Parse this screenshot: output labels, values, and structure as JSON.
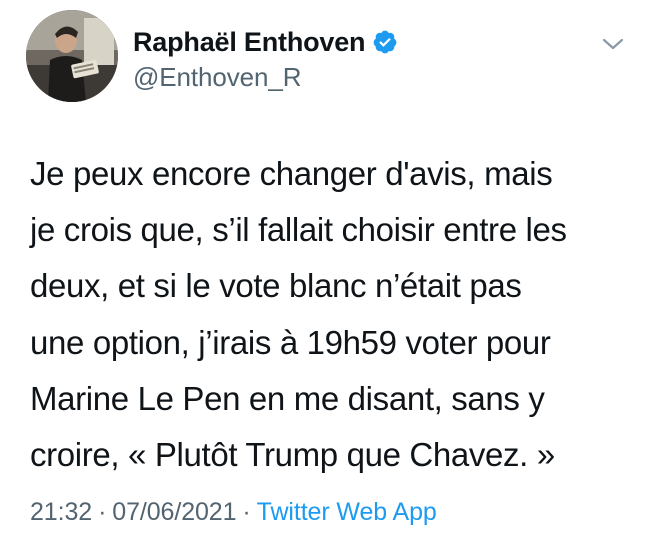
{
  "tweet": {
    "author": {
      "display_name": "Raphaël Enthoven",
      "handle": "@Enthoven_R",
      "verified": true
    },
    "text_lines": [
      "Je peux encore changer d'avis, mais",
      "je crois que, s’il fallait choisir entre les",
      "deux, et si le vote blanc n’était pas",
      "une option, j’irais à 19h59 voter pour",
      "Marine Le Pen en me disant, sans y",
      "croire, « Plutôt Trump que Chavez. »"
    ],
    "time": "21:32",
    "separator": "·",
    "date": "07/06/2021",
    "source": "Twitter Web App"
  },
  "icons": {
    "verified": "verified-badge-icon",
    "more": "chevron-down-icon"
  },
  "colors": {
    "text": "#0f1419",
    "secondary": "#536471",
    "accent": "#1d9bf0"
  }
}
